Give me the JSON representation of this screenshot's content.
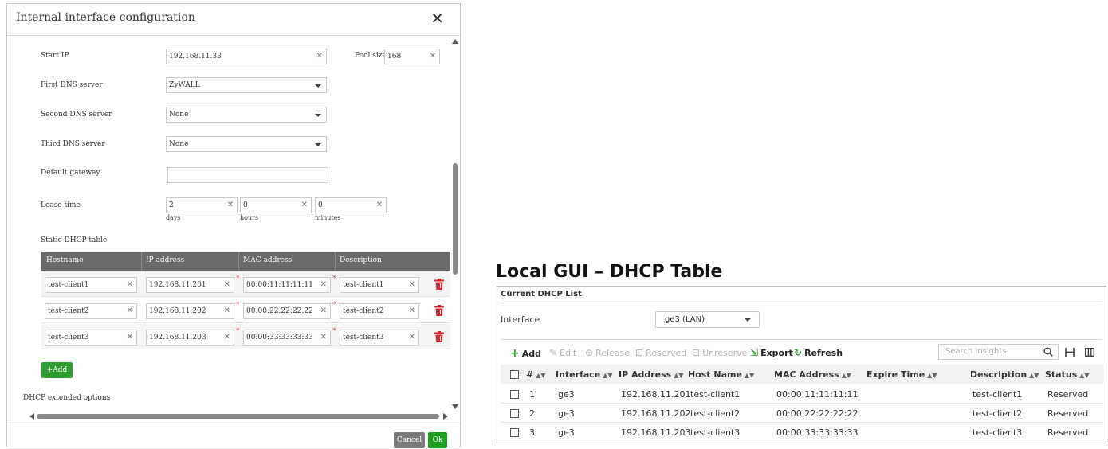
{
  "dialog": {
    "title": "Internal interface configuration",
    "close_glyph": "✕",
    "start_ip": {
      "label": "Start IP",
      "value": "192.168.11.33"
    },
    "pool_size": {
      "label": "Pool size",
      "value": "168"
    },
    "first_dns": {
      "label": "First DNS server",
      "value": "ZyWALL"
    },
    "second_dns": {
      "label": "Second DNS server",
      "value": "None"
    },
    "third_dns": {
      "label": "Third DNS server",
      "value": "None"
    },
    "gateway": {
      "label": "Default gateway",
      "value": ""
    },
    "lease": {
      "label": "Lease time",
      "days": "2",
      "days_label": "days",
      "hours": "0",
      "hours_label": "hours",
      "minutes": "0",
      "minutes_label": "minutes"
    },
    "static_table": {
      "label": "Static DHCP table",
      "columns": [
        "Hostname",
        "IP address",
        "MAC address",
        "Description"
      ],
      "rows": [
        {
          "hostname": "test-client1",
          "ip": "192.168.11.201",
          "mac": "00:00:11:11:11:11",
          "desc": "test-client1"
        },
        {
          "hostname": "test-client2",
          "ip": "192.168.11.202",
          "mac": "00:00:22:22:22:22",
          "desc": "test-client2"
        },
        {
          "hostname": "test-client3",
          "ip": "192.168.11.203",
          "mac": "00:00:33:33:33:33",
          "desc": "test-client3"
        }
      ]
    },
    "add_label": "+Add",
    "extended_label": "DHCP extended options",
    "cancel_label": "Cancel",
    "ok_label": "Ok",
    "colors": {
      "header_bg": "#6a6a6a",
      "add_green": "#2e9c2e",
      "trash_red": "#e0202a",
      "cancel_gray": "#7a7a7a",
      "ok_green": "#1e9e1e"
    }
  },
  "gui": {
    "heading": "Local GUI – DHCP Table",
    "panel_title": "Current DHCP List",
    "interface_label": "Interface",
    "interface_value": "ge3 (LAN)",
    "toolbar": {
      "add": "Add",
      "edit": "Edit",
      "release": "Release",
      "reserved": "Reserved",
      "unreserve": "Unreserve",
      "export": "Export",
      "refresh": "Refresh"
    },
    "search_placeholder": "Search insights",
    "columns": [
      "#",
      "Interface",
      "IP Address",
      "Host Name",
      "MAC Address",
      "Expire Time",
      "Description",
      "Status"
    ],
    "rows": [
      {
        "num": "1",
        "iface": "ge3",
        "ip": "192.168.11.201",
        "host": "test-client1",
        "mac": "00:00:11:11:11:11",
        "expire": "",
        "desc": "test-client1",
        "status": "Reserved"
      },
      {
        "num": "2",
        "iface": "ge3",
        "ip": "192.168.11.202",
        "host": "test-client2",
        "mac": "00:00:22:22:22:22",
        "expire": "",
        "desc": "test-client2",
        "status": "Reserved"
      },
      {
        "num": "3",
        "iface": "ge3",
        "ip": "192.168.11.203",
        "host": "test-client3",
        "mac": "00:00:33:33:33:33",
        "expire": "",
        "desc": "test-client3",
        "status": "Reserved"
      }
    ],
    "colors": {
      "accent_green": "#2e9c2e",
      "disabled": "#b4b4b4"
    }
  }
}
